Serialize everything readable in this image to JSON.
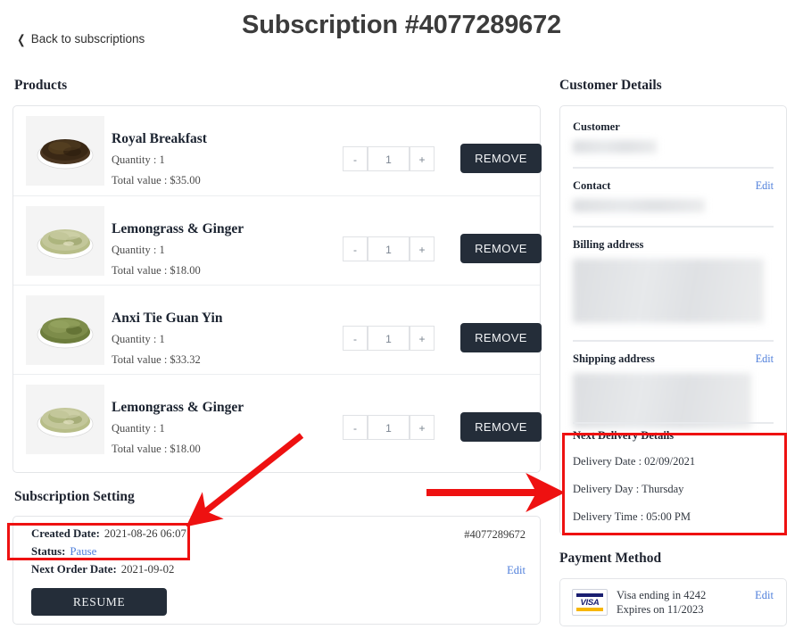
{
  "header": {
    "title": "Subscription #4077289672",
    "back_label": "Back to subscriptions",
    "back_icon": "chevron-left-icon"
  },
  "sections": {
    "products": "Products",
    "subscription_setting": "Subscription Setting",
    "customer_details": "Customer Details",
    "payment_method": "Payment Method"
  },
  "products": {
    "items": [
      {
        "name": "Royal Breakfast",
        "quantity_label": "Quantity : 1",
        "total_label": "Total value : $35.00",
        "quantity": "1",
        "minus": "-",
        "plus": "+",
        "remove_label": "REMOVE",
        "thumb": "black-tea-leaves-dish",
        "leaf_color": "#4a3520",
        "leaf_color_2": "#2f2113"
      },
      {
        "name": "Lemongrass & Ginger",
        "quantity_label": "Quantity : 1",
        "total_label": "Total value : $18.00",
        "quantity": "1",
        "minus": "-",
        "plus": "+",
        "remove_label": "REMOVE",
        "thumb": "herbal-lemongrass-dish",
        "leaf_color": "#b7bd88",
        "leaf_color_2": "#8d9760"
      },
      {
        "name": "Anxi Tie Guan Yin",
        "quantity_label": "Quantity : 1",
        "total_label": "Total value : $33.32",
        "quantity": "1",
        "minus": "-",
        "plus": "+",
        "remove_label": "REMOVE",
        "thumb": "green-oolong-dish",
        "leaf_color": "#7d8c4a",
        "leaf_color_2": "#56662b"
      },
      {
        "name": "Lemongrass & Ginger",
        "quantity_label": "Quantity : 1",
        "total_label": "Total value : $18.00",
        "quantity": "1",
        "minus": "-",
        "plus": "+",
        "remove_label": "REMOVE",
        "thumb": "herbal-lemongrass-dish",
        "leaf_color": "#b7bd88",
        "leaf_color_2": "#8d9760"
      }
    ]
  },
  "subscription_setting": {
    "created_date_label": "Created Date:",
    "created_date_value": "2021-08-26 06:07",
    "status_label": "Status:",
    "status_value": "Pause",
    "next_order_label": "Next Order Date:",
    "next_order_value": "2021-09-02",
    "subscription_id": "#4077289672",
    "edit_label": "Edit",
    "resume_label": "RESUME"
  },
  "customer": {
    "customer_label": "Customer",
    "contact_label": "Contact",
    "contact_edit": "Edit",
    "billing_label": "Billing address",
    "shipping_label": "Shipping address",
    "shipping_edit": "Edit"
  },
  "next_delivery": {
    "title": "Next Delivery Details",
    "date": "Delivery Date : 02/09/2021",
    "day": "Delivery Day : Thursday",
    "time": "Delivery Time : 05:00 PM"
  },
  "payment": {
    "card_brand": "VISA",
    "line1": "Visa ending in 4242",
    "line2": "Expires on 11/2023",
    "edit_label": "Edit"
  },
  "colors": {
    "accent_dark": "#242d39",
    "link_blue": "#4f7fdb",
    "annotation_red": "#ee1111",
    "visa_navy": "#1a1f71",
    "visa_gold": "#f7b600"
  }
}
